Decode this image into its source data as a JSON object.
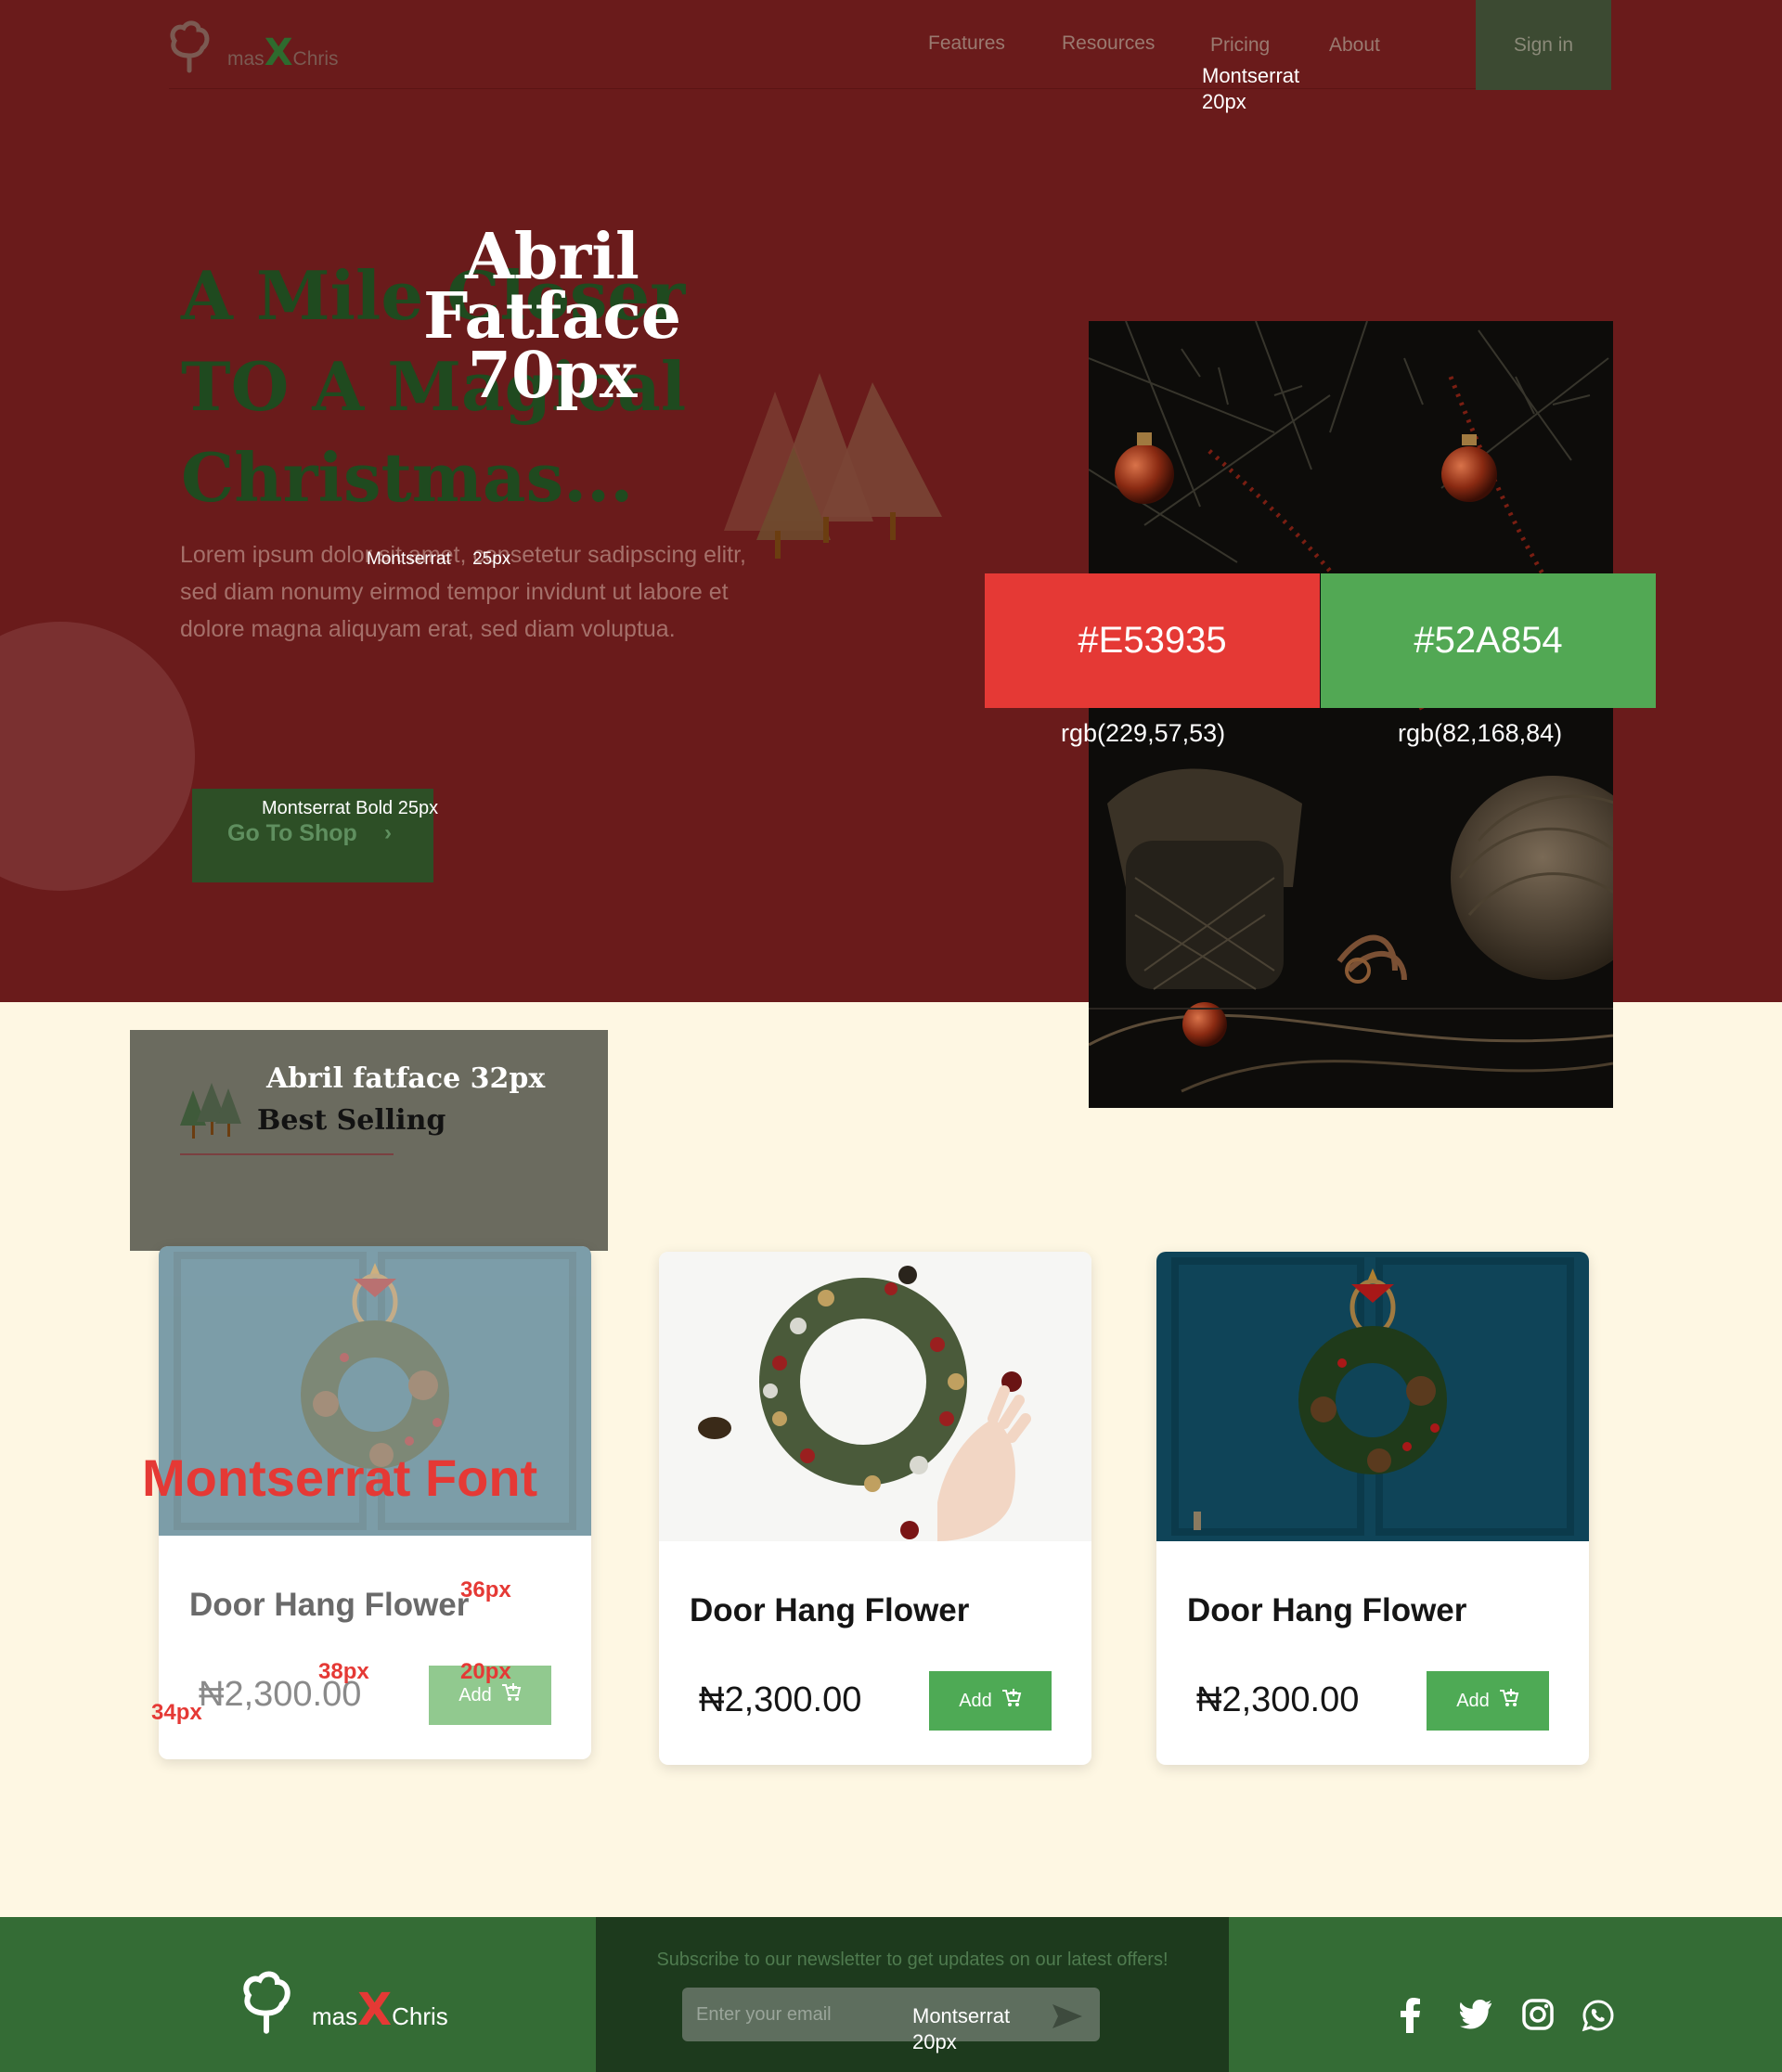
{
  "nav": {
    "logo_left": "mas",
    "logo_x": "X",
    "logo_right": "Chris",
    "links": [
      "Features",
      "Resources",
      "Pricing",
      "About"
    ],
    "signin": "Sign in",
    "annotation_line1": "Montserrat",
    "annotation_line2": "20px"
  },
  "hero": {
    "title_line1": "A Mile Closer",
    "title_line2": "TO A Magical",
    "title_line3": "Christmas...",
    "font_annotation_line1": "Abril Fatface",
    "font_annotation_line2": "70px",
    "subtitle": "Lorem ipsum dolor sit amet, consetetur sadipscing elitr, sed diam nonumy eirmod tempor invidunt ut labore et dolore magna aliquyam erat, sed diam voluptua.",
    "subtitle_annotation_font": "Montserrat",
    "subtitle_annotation_size": "25px",
    "cta_label": "Go To Shop",
    "cta_annotation": "Montserrat Bold 25px"
  },
  "palette": {
    "red_hex": "#E53935",
    "red_rgb": "rgb(229,57,53)",
    "green_hex": "#52A854",
    "green_rgb": "rgb(82,168,84)"
  },
  "best_selling": {
    "annotation": "Abril fatface 32px",
    "title": "Best Selling"
  },
  "products": [
    {
      "title": "Door Hang Flower",
      "price": "₦2,300.00",
      "add_label": "Add"
    },
    {
      "title": "Door Hang Flower",
      "price": "₦2,300.00",
      "add_label": "Add"
    },
    {
      "title": "Door Hang Flower",
      "price": "₦2,300.00",
      "add_label": "Add"
    }
  ],
  "annotations": {
    "montserrat_font": "Montserrat Font",
    "title_size": "36px",
    "price_size": "38px",
    "button_size": "20px",
    "currency_size": "34px"
  },
  "footer": {
    "logo_left": "mas",
    "logo_x": "X",
    "logo_right": "Chris",
    "newsletter": "Subscribe to our newsletter to get updates on our latest offers!",
    "email_placeholder": "Enter your email",
    "annotation_line1": "Montserrat",
    "annotation_line2": "20px",
    "social": [
      "facebook-icon",
      "twitter-icon",
      "instagram-icon",
      "whatsapp-icon"
    ]
  }
}
